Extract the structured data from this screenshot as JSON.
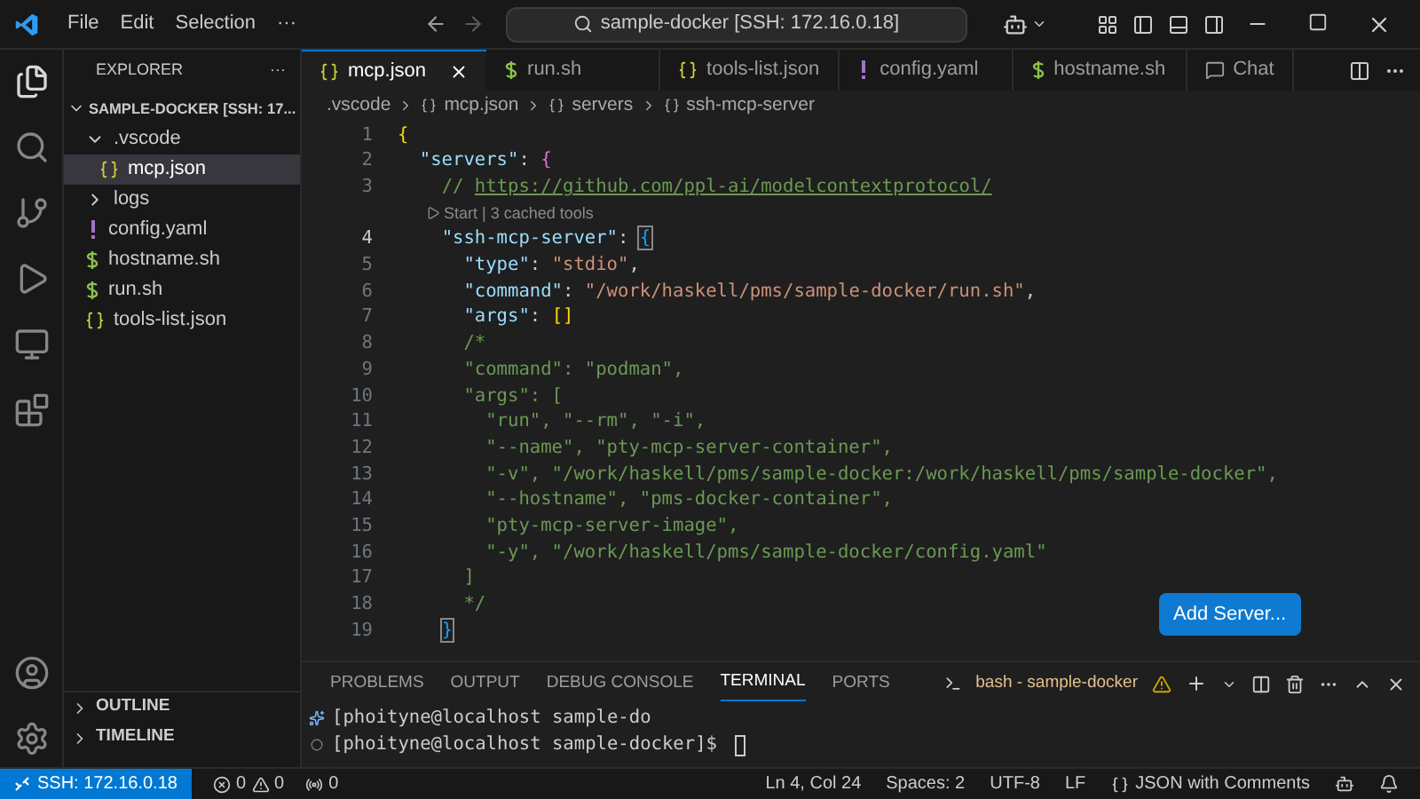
{
  "title_bar": {
    "menu": [
      "File",
      "Edit",
      "Selection",
      "···"
    ],
    "command_center": "sample-docker [SSH: 172.16.0.18]"
  },
  "sidebar": {
    "title": "EXPLORER",
    "more": "···",
    "root": "SAMPLE-DOCKER [SSH: 17...",
    "tree": [
      {
        "kind": "folder",
        "label": ".vscode",
        "expanded": true,
        "selected": false,
        "children": [
          {
            "kind": "json",
            "label": "mcp.json",
            "selected": true
          }
        ]
      },
      {
        "kind": "folder",
        "label": "logs",
        "expanded": false,
        "selected": false
      },
      {
        "kind": "yaml",
        "label": "config.yaml",
        "selected": false
      },
      {
        "kind": "shell",
        "label": "hostname.sh",
        "selected": false
      },
      {
        "kind": "shell",
        "label": "run.sh",
        "selected": false
      },
      {
        "kind": "json",
        "label": "tools-list.json",
        "selected": false
      }
    ],
    "sections": [
      {
        "label": "OUTLINE",
        "expanded": false
      },
      {
        "label": "TIMELINE",
        "expanded": false
      }
    ]
  },
  "tabs": [
    {
      "kind": "json",
      "label": "mcp.json",
      "selected": true
    },
    {
      "kind": "shell",
      "label": "run.sh",
      "selected": false
    },
    {
      "kind": "json",
      "label": "tools-list.json",
      "selected": false
    },
    {
      "kind": "yaml",
      "label": "config.yaml",
      "selected": false
    },
    {
      "kind": "shell",
      "label": "hostname.sh",
      "selected": false
    },
    {
      "kind": "chat",
      "label": "Chat",
      "selected": false
    }
  ],
  "breadcrumb": [
    ".vscode",
    "mcp.json",
    "servers",
    "ssh-mcp-server"
  ],
  "code": [
    {
      "number": "1",
      "tokens": [
        {
          "kind": "bracket1",
          "text": "{"
        }
      ]
    },
    {
      "number": "2",
      "tokens": [
        {
          "kind": "key",
          "text": "  \"servers\""
        },
        {
          "kind": "plain",
          "text": ": "
        },
        {
          "kind": "bracket2",
          "text": "{"
        }
      ]
    },
    {
      "number": "3",
      "tokens": [
        {
          "kind": "comment",
          "text": "    // "
        },
        {
          "kind": "link",
          "text": "https://github.com/ppl-ai/modelcontextprotocol/"
        }
      ]
    },
    {
      "lens": "Start | 3 cached tools"
    },
    {
      "number": "4",
      "tokens": [
        {
          "kind": "key",
          "text": "    \"ssh-mcp-server\""
        },
        {
          "kind": "plain",
          "text": ": "
        },
        {
          "kind": "bracket3",
          "text": "{"
        }
      ]
    },
    {
      "number": "5",
      "tokens": [
        {
          "kind": "key",
          "text": "      \"type\""
        },
        {
          "kind": "plain",
          "text": ": "
        },
        {
          "kind": "string",
          "text": "\"stdio\""
        },
        {
          "kind": "plain",
          "text": ","
        }
      ]
    },
    {
      "number": "6",
      "tokens": [
        {
          "kind": "key",
          "text": "      \"command\""
        },
        {
          "kind": "plain",
          "text": ": "
        },
        {
          "kind": "string",
          "text": "\"/work/haskell/pms/sample-docker/run.sh\""
        },
        {
          "kind": "plain",
          "text": ","
        }
      ]
    },
    {
      "number": "7",
      "tokens": [
        {
          "kind": "key",
          "text": "      \"args\""
        },
        {
          "kind": "plain",
          "text": ": "
        },
        {
          "kind": "bracket1",
          "text": "[]"
        }
      ]
    },
    {
      "number": "8",
      "tokens": [
        {
          "kind": "comment",
          "text": "      /*"
        }
      ]
    },
    {
      "number": "9",
      "tokens": [
        {
          "kind": "comment",
          "text": "      \"command\": \"podman\","
        }
      ]
    },
    {
      "number": "10",
      "tokens": [
        {
          "kind": "comment",
          "text": "      \"args\": ["
        }
      ]
    },
    {
      "number": "11",
      "tokens": [
        {
          "kind": "comment",
          "text": "        \"run\", \"--rm\", \"-i\","
        }
      ]
    },
    {
      "number": "12",
      "tokens": [
        {
          "kind": "comment",
          "text": "        \"--name\", \"pty-mcp-server-container\","
        }
      ]
    },
    {
      "number": "13",
      "tokens": [
        {
          "kind": "comment",
          "text": "        \"-v\", \"/work/haskell/pms/sample-docker:/work/haskell/pms/sample-docker\","
        }
      ]
    },
    {
      "number": "14",
      "tokens": [
        {
          "kind": "comment",
          "text": "        \"--hostname\", \"pms-docker-container\","
        }
      ]
    },
    {
      "number": "15",
      "tokens": [
        {
          "kind": "comment",
          "text": "        \"pty-mcp-server-image\","
        }
      ]
    },
    {
      "number": "16",
      "tokens": [
        {
          "kind": "comment",
          "text": "        \"-y\", \"/work/haskell/pms/sample-docker/config.yaml\""
        }
      ]
    },
    {
      "number": "17",
      "tokens": [
        {
          "kind": "comment",
          "text": "      ]"
        }
      ]
    },
    {
      "number": "18",
      "tokens": [
        {
          "kind": "comment",
          "text": "      */"
        }
      ]
    },
    {
      "number": "19",
      "tokens": [
        {
          "kind": "bracket3",
          "text": "    }"
        }
      ]
    }
  ],
  "add_server_button": "Add Server...",
  "panel": {
    "tabs": [
      {
        "label": "PROBLEMS",
        "selected": false
      },
      {
        "label": "OUTPUT",
        "selected": false
      },
      {
        "label": "DEBUG CONSOLE",
        "selected": false
      },
      {
        "label": "TERMINAL",
        "selected": true
      },
      {
        "label": "PORTS",
        "selected": false
      }
    ],
    "terminal_name": "bash - sample-docker",
    "lines": [
      {
        "kind": "sparkle",
        "text": "[phoityne@localhost sample-do"
      },
      {
        "kind": "circle",
        "text": "[phoityne@localhost sample-docker]$ "
      }
    ]
  },
  "status_bar": {
    "remote": "SSH: 172.16.0.18",
    "errors": "0",
    "warnings": "0",
    "ports": "0",
    "position": "Ln 4, Col 24",
    "indent": "Spaces: 2",
    "encoding": "UTF-8",
    "eol": "LF",
    "language": "JSON with Comments"
  }
}
